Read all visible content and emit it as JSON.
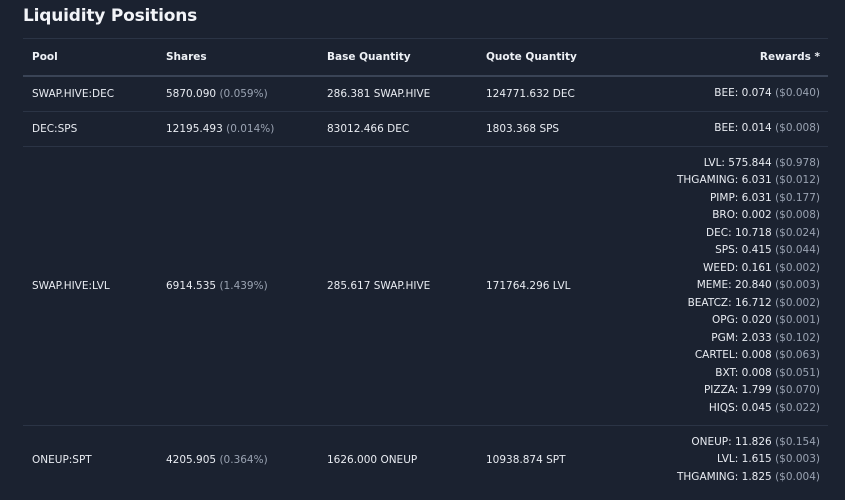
{
  "title": "Liquidity Positions",
  "columns": [
    "Pool",
    "Shares",
    "Base Quantity",
    "Quote Quantity",
    "Rewards *"
  ],
  "rows": [
    {
      "pool": "SWAP.HIVE:DEC",
      "shares": "5870.090",
      "share_pct": "(0.059%)",
      "base": "286.381 SWAP.HIVE",
      "quote": "124771.632 DEC",
      "rewards": [
        {
          "amount": "BEE: 0.074",
          "usd": "($0.040)"
        }
      ]
    },
    {
      "pool": "DEC:SPS",
      "shares": "12195.493",
      "share_pct": "(0.014%)",
      "base": "83012.466 DEC",
      "quote": "1803.368 SPS",
      "rewards": [
        {
          "amount": "BEE: 0.014",
          "usd": "($0.008)"
        }
      ]
    },
    {
      "pool": "SWAP.HIVE:LVL",
      "shares": "6914.535",
      "share_pct": "(1.439%)",
      "base": "285.617 SWAP.HIVE",
      "quote": "171764.296 LVL",
      "rewards": [
        {
          "amount": "LVL: 575.844",
          "usd": "($0.978)"
        },
        {
          "amount": "THGAMING: 6.031",
          "usd": "($0.012)"
        },
        {
          "amount": "PIMP: 6.031",
          "usd": "($0.177)"
        },
        {
          "amount": "BRO: 0.002",
          "usd": "($0.008)"
        },
        {
          "amount": "DEC: 10.718",
          "usd": "($0.024)"
        },
        {
          "amount": "SPS: 0.415",
          "usd": "($0.044)"
        },
        {
          "amount": "WEED: 0.161",
          "usd": "($0.002)"
        },
        {
          "amount": "MEME: 20.840",
          "usd": "($0.003)"
        },
        {
          "amount": "BEATCZ: 16.712",
          "usd": "($0.002)"
        },
        {
          "amount": "OPG: 0.020",
          "usd": "($0.001)"
        },
        {
          "amount": "PGM: 2.033",
          "usd": "($0.102)"
        },
        {
          "amount": "CARTEL: 0.008",
          "usd": "($0.063)"
        },
        {
          "amount": "BXT: 0.008",
          "usd": "($0.051)"
        },
        {
          "amount": "PIZZA: 1.799",
          "usd": "($0.070)"
        },
        {
          "amount": "HIQS: 0.045",
          "usd": "($0.022)"
        }
      ]
    },
    {
      "pool": "ONEUP:SPT",
      "shares": "4205.905",
      "share_pct": "(0.364%)",
      "base": "1626.000 ONEUP",
      "quote": "10938.874 SPT",
      "rewards": [
        {
          "amount": "ONEUP: 11.826",
          "usd": "($0.154)"
        },
        {
          "amount": "LVL: 1.615",
          "usd": "($0.003)"
        },
        {
          "amount": "THGAMING: 1.825",
          "usd": "($0.004)"
        }
      ]
    }
  ]
}
